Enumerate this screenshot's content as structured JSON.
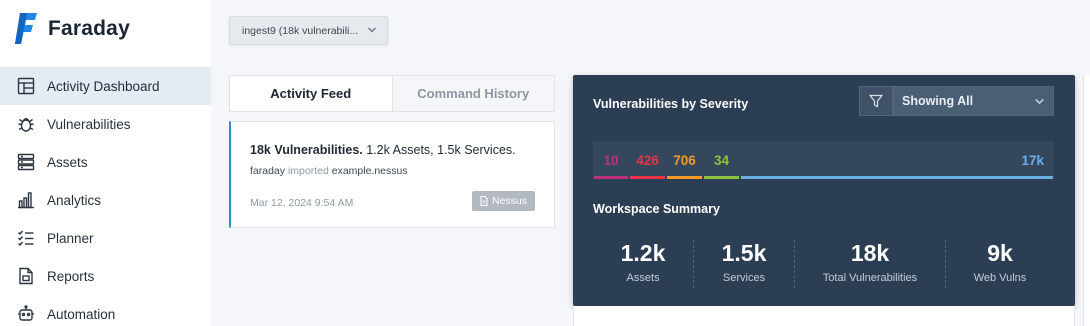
{
  "app": {
    "name": "Faraday"
  },
  "sidebar": {
    "items": [
      {
        "label": "Activity Dashboard",
        "icon": "dashboard-icon",
        "active": true
      },
      {
        "label": "Vulnerabilities",
        "icon": "bug-icon"
      },
      {
        "label": "Assets",
        "icon": "server-icon"
      },
      {
        "label": "Analytics",
        "icon": "bar-chart-icon"
      },
      {
        "label": "Planner",
        "icon": "checklist-icon"
      },
      {
        "label": "Reports",
        "icon": "report-icon"
      },
      {
        "label": "Automation",
        "icon": "robot-icon"
      }
    ]
  },
  "workspace": {
    "selected": "ingest9 (18k vulnerabili..."
  },
  "tabs": [
    {
      "label": "Activity Feed",
      "active": true
    },
    {
      "label": "Command History",
      "active": false
    }
  ],
  "feed": {
    "title_bold": "18k Vulnerabilities.",
    "title_rest": " 1.2k Assets, 1.5k Services.",
    "user": "faraday",
    "verb": "imported",
    "file": "example.nessus",
    "date": "Mar 12, 2024 9:54 AM",
    "badge": "Nessus"
  },
  "severity": {
    "title": "Vulnerabilities by Severity",
    "filter_label": "Showing All",
    "segments": [
      {
        "value": "10",
        "color": "#c0307a"
      },
      {
        "value": "426",
        "color": "#e8334a"
      },
      {
        "value": "706",
        "color": "#f39a2b"
      },
      {
        "value": "34",
        "color": "#8bc540"
      },
      {
        "value": "17k",
        "color": "#6aaee6"
      }
    ]
  },
  "summary": {
    "title": "Workspace Summary",
    "stats": [
      {
        "value": "1.2k",
        "label": "Assets"
      },
      {
        "value": "1.5k",
        "label": "Services"
      },
      {
        "value": "18k",
        "label": "Total Vulnerabilities"
      },
      {
        "value": "9k",
        "label": "Web Vulns"
      }
    ]
  }
}
